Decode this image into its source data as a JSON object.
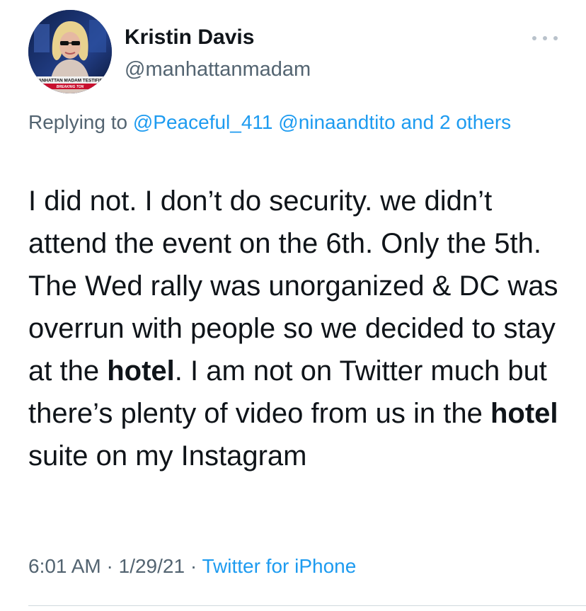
{
  "tweet": {
    "author": {
      "name": "Kristin Davis",
      "handle": "@manhattanmadam",
      "avatar_caption": "MANHATTAN MADAM TESTIFIES",
      "avatar_ticker": "BREAKING TON"
    },
    "reply": {
      "prefix": "Replying to",
      "mentions": [
        "@Peaceful_411",
        "@ninaandtito"
      ],
      "and": "and",
      "others": "2 others"
    },
    "body": {
      "part1": "I did not. I don’t do security. we didn’t attend the event on the 6th. Only the 5th. The Wed rally was unorganized & DC was overrun with people so we decided to stay at the ",
      "highlight1": "hotel",
      "part2": ". I am not on Twitter much but there’s plenty of video from us in the ",
      "highlight2": "hotel",
      "part3": " suite on my Instagram"
    },
    "meta": {
      "time": "6:01 AM",
      "date": "1/29/21",
      "separator": "·",
      "source": "Twitter for iPhone"
    }
  },
  "colors": {
    "text": "#0f1419",
    "secondary": "#536471",
    "link": "#1d9bf0",
    "divider": "#cfd9de"
  },
  "icons": {
    "more": "more-horizontal-icon"
  }
}
